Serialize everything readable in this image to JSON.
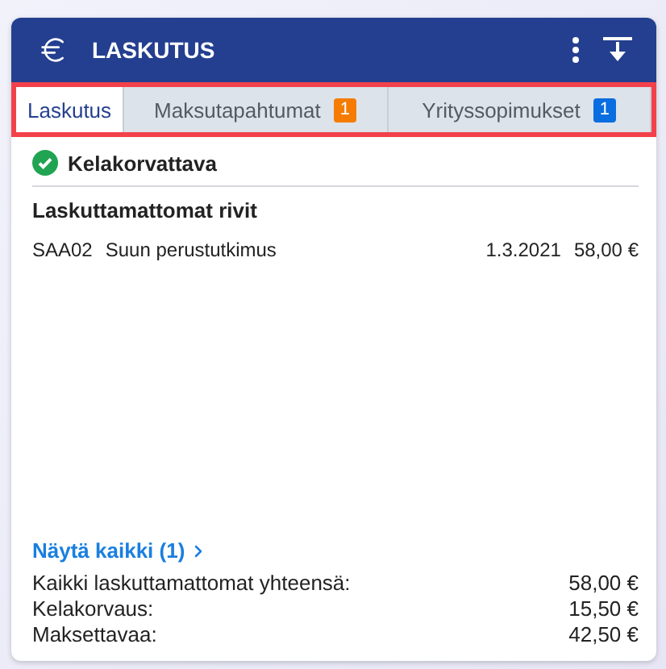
{
  "header": {
    "title": "LASKUTUS"
  },
  "tabs": [
    {
      "label": "Laskutus",
      "selected": true
    },
    {
      "label": "Maksutapahtumat",
      "selected": false,
      "badge": "1",
      "color": "#f57c00"
    },
    {
      "label": "Yrityssopimukset",
      "selected": false,
      "badge": "1",
      "color": "#0a6ee0"
    }
  ],
  "status": {
    "label": "Kelakorvattava",
    "checked": true
  },
  "section_title": "Laskuttamattomat rivit",
  "rows": [
    {
      "code": "SAA02",
      "description": "Suun perustutkimus",
      "date": "1.3.2021",
      "amount": "58,00 €"
    }
  ],
  "show_all": "Näytä kaikki (1)",
  "totals": [
    {
      "label": "Kaikki laskuttamattomat yhteensä:",
      "value": "58,00 €"
    },
    {
      "label": "Kelakorvaus:",
      "value": "15,50 €"
    },
    {
      "label": "Maksettavaa:",
      "value": "42,50 €"
    }
  ]
}
